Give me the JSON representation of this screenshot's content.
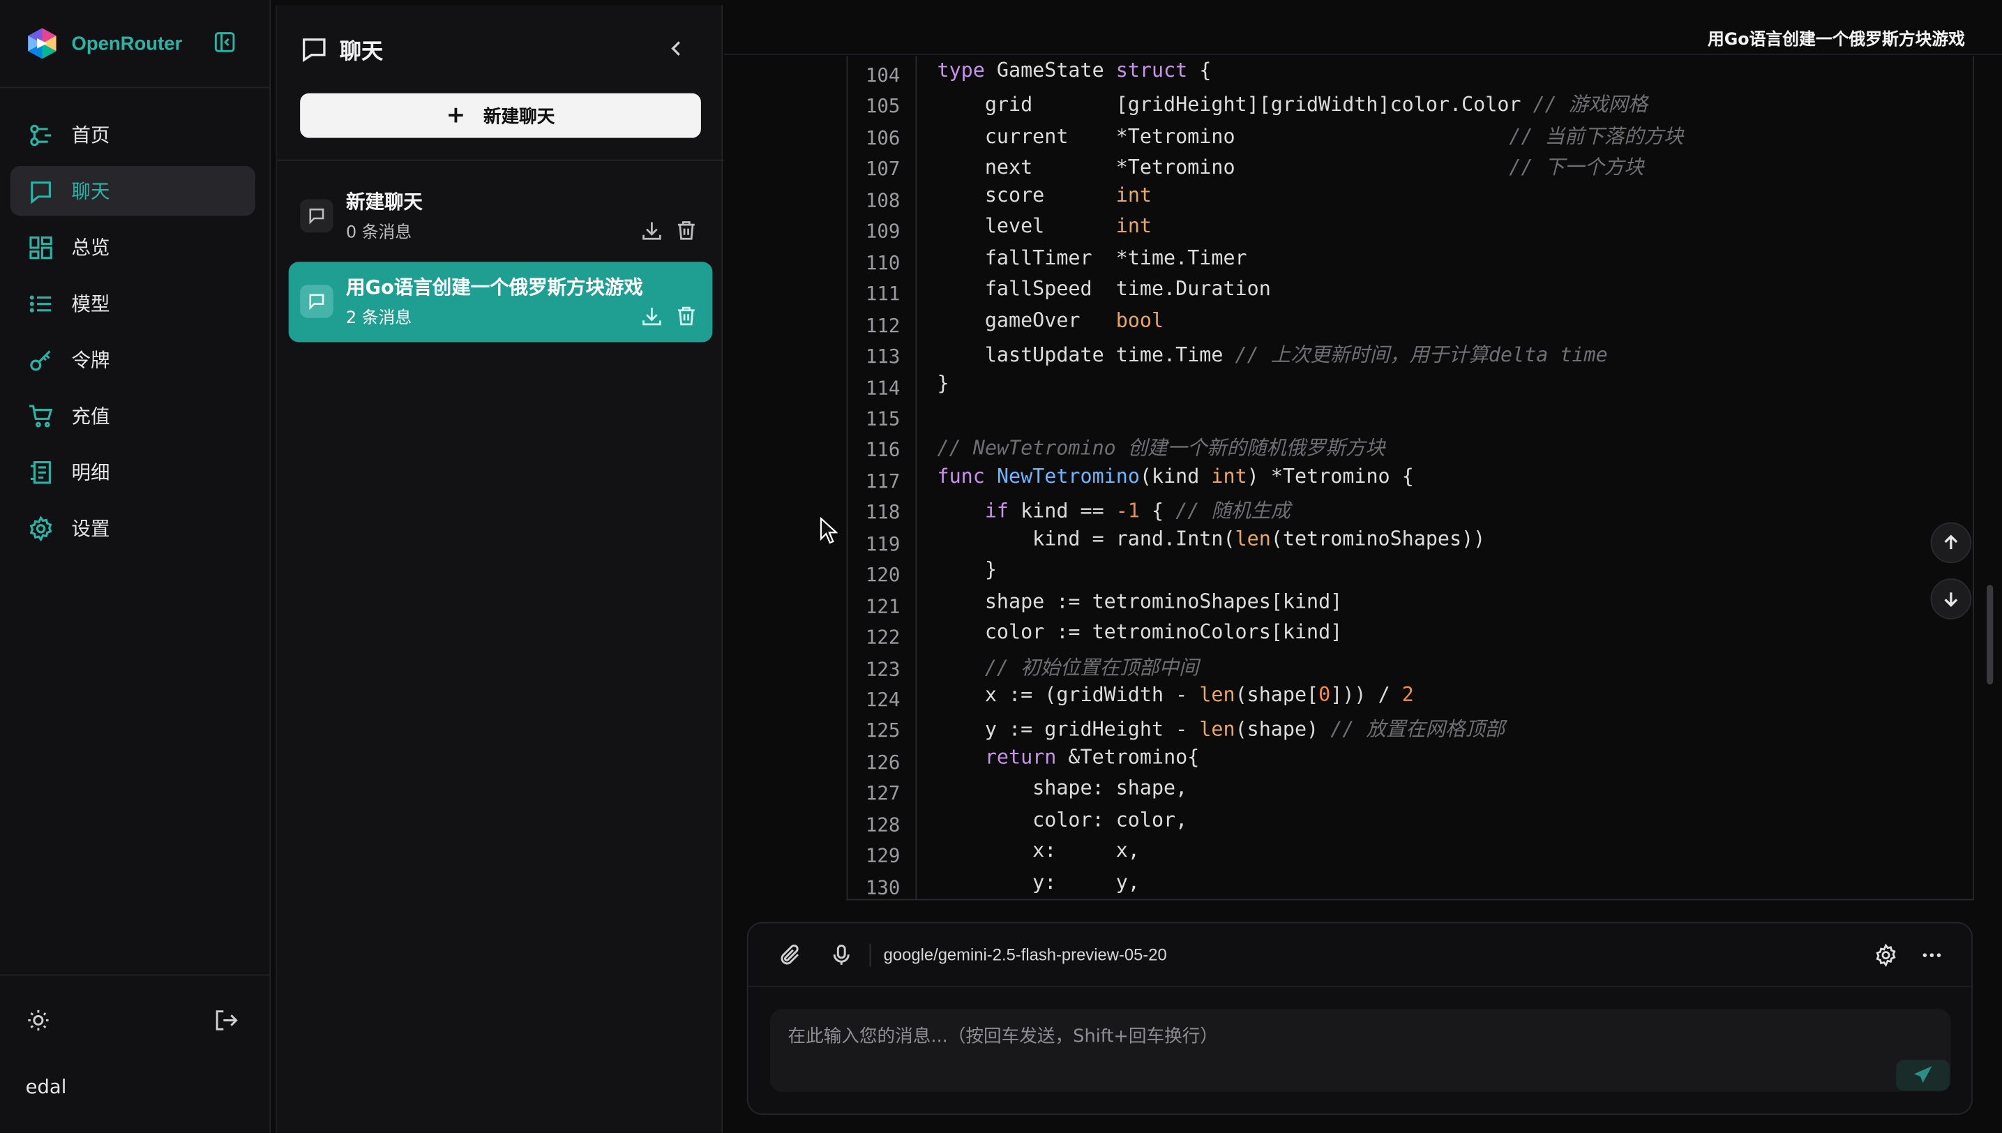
{
  "brand": {
    "name": "OpenRouter"
  },
  "nav": {
    "items": [
      {
        "label": "首页",
        "icon": "home-icon",
        "active": false
      },
      {
        "label": "聊天",
        "icon": "chat-icon",
        "active": true
      },
      {
        "label": "总览",
        "icon": "dashboard-icon",
        "active": false
      },
      {
        "label": "模型",
        "icon": "list-icon",
        "active": false
      },
      {
        "label": "令牌",
        "icon": "key-icon",
        "active": false
      },
      {
        "label": "充值",
        "icon": "cart-icon",
        "active": false
      },
      {
        "label": "明细",
        "icon": "receipt-icon",
        "active": false
      },
      {
        "label": "设置",
        "icon": "gear-icon",
        "active": false
      }
    ],
    "username": "edal"
  },
  "chats": {
    "title": "聊天",
    "new_chat_label": "新建聊天",
    "items": [
      {
        "title": "新建聊天",
        "count": "0 条消息",
        "active": false
      },
      {
        "title": "用Go语言创建一个俄罗斯方块游戏",
        "count": "2 条消息",
        "active": true
      }
    ]
  },
  "main": {
    "conversation_title": "用Go语言创建一个俄罗斯方块游戏",
    "code": {
      "language": "go",
      "line_numbers": [
        "104",
        "105",
        "106",
        "107",
        "108",
        "109",
        "110",
        "111",
        "112",
        "113",
        "114",
        "115",
        "116",
        "117",
        "118",
        "119",
        "120",
        "121",
        "122",
        "123",
        "124",
        "125",
        "126",
        "127",
        "128",
        "129",
        "130"
      ],
      "lines": [
        "type GameState struct {",
        "    grid       [gridHeight][gridWidth]color.Color // 游戏网格",
        "    current    *Tetromino                       // 当前下落的方块",
        "    next       *Tetromino                       // 下一个方块",
        "    score      int",
        "    level      int",
        "    fallTimer  *time.Timer",
        "    fallSpeed  time.Duration",
        "    gameOver   bool",
        "    lastUpdate time.Time // 上次更新时间，用于计算delta time",
        "}",
        "",
        "// NewTetromino 创建一个新的随机俄罗斯方块",
        "func NewTetromino(kind int) *Tetromino {",
        "    if kind == -1 { // 随机生成",
        "        kind = rand.Intn(len(tetrominoShapes))",
        "    }",
        "    shape := tetrominoShapes[kind]",
        "    color := tetrominoColors[kind]",
        "    // 初始位置在顶部中间",
        "    x := (gridWidth - len(shape[0])) / 2",
        "    y := gridHeight - len(shape) // 放置在网格顶部",
        "    return &Tetromino{",
        "        shape: shape,",
        "        color: color,",
        "        x:     x,",
        "        y:     y,"
      ]
    },
    "composer": {
      "model": "google/gemini-2.5-flash-preview-05-20",
      "placeholder": "在此输入您的消息...（按回车发送，Shift+回车换行）",
      "value": ""
    }
  },
  "colors": {
    "accent": "#2bb3a6",
    "active_chat_bg": "#1f9e92",
    "background": "#0b0b0c",
    "keyword": "#c792ea",
    "type": "#e8a764",
    "function": "#6cb6ff",
    "number": "#f08d49",
    "comment": "#6e6e73"
  }
}
